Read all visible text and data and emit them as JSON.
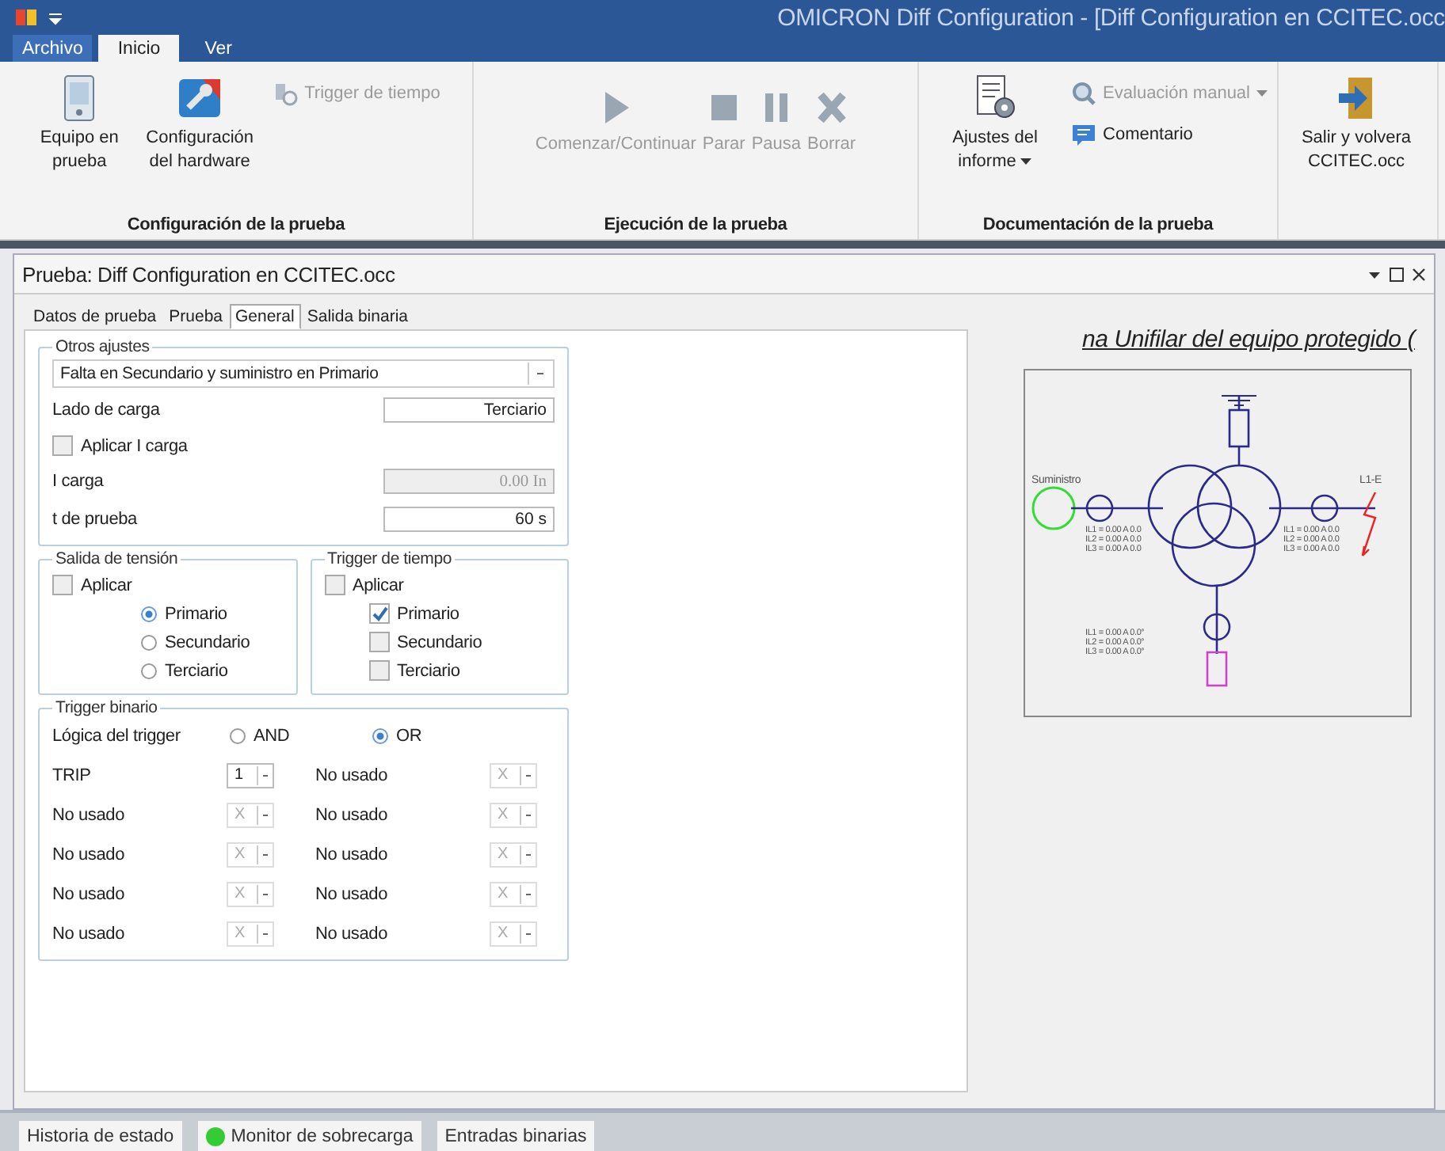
{
  "window": {
    "title": "OMICRON Diff Configuration - [Diff Configuration en CCITEC.occ"
  },
  "ribbon_tabs": [
    {
      "label": "Archivo",
      "kind": "file",
      "selected": false
    },
    {
      "label": "Inicio",
      "kind": "tab",
      "selected": true
    },
    {
      "label": "Ver",
      "kind": "tab",
      "selected": false
    }
  ],
  "ribbon_groups": [
    {
      "label": "Configuración de la prueba",
      "buttons": [
        {
          "label": "Equipo en prueba",
          "kind": "large",
          "disabled": false
        },
        {
          "label": "Configuración del hardware",
          "kind": "large",
          "disabled": false
        },
        {
          "label": "Trigger de tiempo",
          "kind": "small",
          "disabled": true
        }
      ]
    },
    {
      "label": "Ejecución de la prueba",
      "buttons": [
        {
          "label": "Comenzar/Continuar",
          "kind": "large",
          "disabled": true
        },
        {
          "label": "Parar",
          "kind": "large",
          "disabled": true
        },
        {
          "label": "Pausa",
          "kind": "large",
          "disabled": true
        },
        {
          "label": "Borrar",
          "kind": "large",
          "disabled": true
        }
      ]
    },
    {
      "label": "Documentación de la prueba",
      "buttons": [
        {
          "label": "Ajustes del informe",
          "kind": "large",
          "disabled": false,
          "dropdown": true
        },
        {
          "label": "Evaluación manual",
          "kind": "small",
          "disabled": true,
          "dropdown": true
        },
        {
          "label": "Comentario",
          "kind": "small",
          "disabled": false
        }
      ]
    },
    {
      "buttons": [
        {
          "label": "Salir y volvera CCITEC.occ",
          "kind": "large",
          "disabled": false
        }
      ]
    }
  ],
  "panel": {
    "title": "Prueba: Diff Configuration en CCITEC.occ"
  },
  "tabs": [
    {
      "label": "Datos de prueba",
      "selected": false
    },
    {
      "label": "Prueba",
      "selected": false
    },
    {
      "label": "General",
      "selected": true
    },
    {
      "label": "Salida binaria",
      "selected": false
    }
  ],
  "otros_ajustes": {
    "title": "Otros ajustes",
    "rows": [
      {
        "kind": "dropdown",
        "value": "Falta en Secundario y suministro en Primario"
      },
      {
        "kind": "field",
        "label": "Lado de carga",
        "value": "Terciario",
        "disabled": false
      },
      {
        "kind": "checkbox",
        "label": "Aplicar I carga",
        "checked": false
      },
      {
        "kind": "field",
        "label": "I carga",
        "value": "0.00 In",
        "disabled": true
      },
      {
        "kind": "field",
        "label": "t de prueba",
        "value": "60 s",
        "disabled": false
      }
    ]
  },
  "salida_tension": {
    "title": "Salida de tensión",
    "apply": {
      "label": "Aplicar",
      "checked": false
    },
    "options": [
      {
        "label": "Primario",
        "selected": true
      },
      {
        "label": "Secundario",
        "selected": false
      },
      {
        "label": "Terciario",
        "selected": false
      }
    ]
  },
  "trigger_tiempo": {
    "title": "Trigger de tiempo",
    "apply": {
      "label": "Aplicar",
      "checked": false
    },
    "options": [
      {
        "label": "Primario",
        "checked": true
      },
      {
        "label": "Secundario",
        "checked": false
      },
      {
        "label": "Terciario",
        "checked": false
      }
    ]
  },
  "trigger_binario": {
    "title": "Trigger binario",
    "logic_label": "Lógica del trigger",
    "logic_options": [
      {
        "label": "AND",
        "selected": false
      },
      {
        "label": "OR",
        "selected": true
      }
    ],
    "inputs": [
      {
        "label": "TRIP",
        "value": "1",
        "disabled": false
      },
      {
        "label": "No usado",
        "value": "X",
        "disabled": true
      },
      {
        "label": "No usado",
        "value": "X",
        "disabled": true
      },
      {
        "label": "No usado",
        "value": "X",
        "disabled": true
      },
      {
        "label": "No usado",
        "value": "X",
        "disabled": true
      },
      {
        "label": "No usado",
        "value": "X",
        "disabled": true
      },
      {
        "label": "No usado",
        "value": "X",
        "disabled": true
      },
      {
        "label": "No usado",
        "value": "X",
        "disabled": true
      },
      {
        "label": "No usado",
        "value": "X",
        "disabled": true
      },
      {
        "label": "No usado",
        "value": "X",
        "disabled": true
      }
    ]
  },
  "diagram": {
    "title": "na Unifilar del equipo protegido (",
    "source_label": "Suministro",
    "fault_label": "L1-E",
    "left_readings": [
      "IL1 = 0.00 A 0.0",
      "IL2 = 0.00 A 0.0",
      "IL3 = 0.00 A 0.0"
    ],
    "right_readings": [
      "IL1 = 0.00 A 0.0",
      "IL2 = 0.00 A 0.0",
      "IL3 = 0.00 A 0.0"
    ],
    "bottom_readings": [
      "IL1 = 0.00 A 0.0°",
      "IL2 = 0.00 A 0.0°",
      "IL3 = 0.00 A 0.0°"
    ]
  },
  "status_tabs": [
    {
      "label": "Historia de estado"
    },
    {
      "label": "Monitor de sobrecarga",
      "color": "#33cc33"
    },
    {
      "label": "Entradas binarias"
    }
  ]
}
